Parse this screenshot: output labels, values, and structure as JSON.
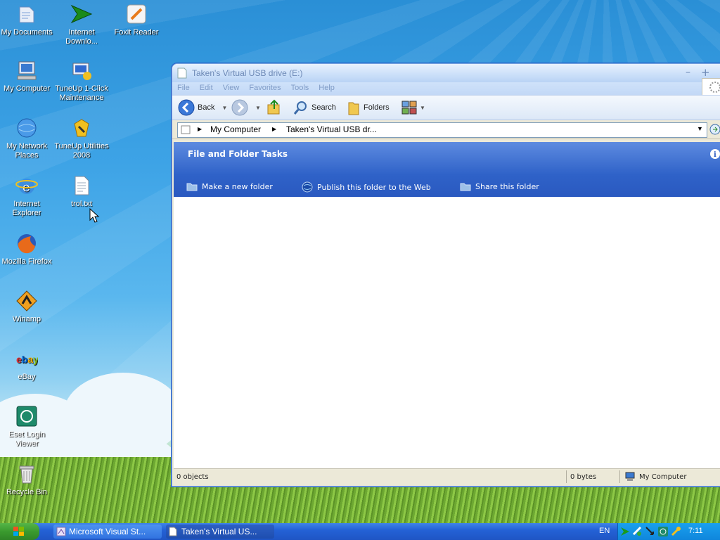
{
  "desktop": {
    "icons": [
      {
        "label": "My Documents",
        "icon": "my-documents-icon"
      },
      {
        "label": "Internet Downlo...",
        "icon": "internet-download-manager-icon"
      },
      {
        "label": "Foxit Reader",
        "icon": "foxit-reader-icon"
      },
      {
        "label": "My Computer",
        "icon": "my-computer-icon"
      },
      {
        "label": "TuneUp 1-Click Maintenance",
        "icon": "tuneup-1-click-icon"
      },
      {
        "label": "My Network Places",
        "icon": "my-network-places-icon"
      },
      {
        "label": "TuneUp Utilities 2008",
        "icon": "tuneup-utilities-icon"
      },
      {
        "label": "Internet Explorer",
        "icon": "internet-explorer-icon"
      },
      {
        "label": "trol.txt",
        "icon": "text-file-icon"
      },
      {
        "label": "Mozilla Firefox",
        "icon": "firefox-icon"
      },
      {
        "label": "Winamp",
        "icon": "winamp-icon"
      },
      {
        "label": "eBay",
        "icon": "ebay-icon"
      },
      {
        "label": "Eset Login Viewer",
        "icon": "eset-login-viewer-icon"
      },
      {
        "label": "Recycle Bin",
        "icon": "recycle-bin-icon"
      }
    ]
  },
  "window": {
    "title": "Taken's Virtual USB drive (E:)",
    "menu": [
      "File",
      "Edit",
      "View",
      "Favorites",
      "Tools",
      "Help"
    ],
    "toolbar": {
      "back": "Back",
      "search": "Search",
      "folders": "Folders"
    },
    "address": {
      "crumb1": "My Computer",
      "crumb2": "Taken's Virtual USB dr..."
    },
    "tasks": {
      "title": "File and Folder Tasks",
      "items": [
        "Make a new folder",
        "Publish this folder to the Web",
        "Share this folder"
      ]
    },
    "status": {
      "objects": "0 objects",
      "size": "0 bytes",
      "location": "My Computer"
    }
  },
  "taskbar": {
    "buttons": [
      "Microsoft Visual St...",
      "Taken's Virtual US..."
    ],
    "language": "EN",
    "clock": "7:11"
  },
  "colors": {
    "title_blue": "#2a59c0",
    "taskbar_blue": "#2462d6",
    "start_green": "#3a9a2e"
  }
}
